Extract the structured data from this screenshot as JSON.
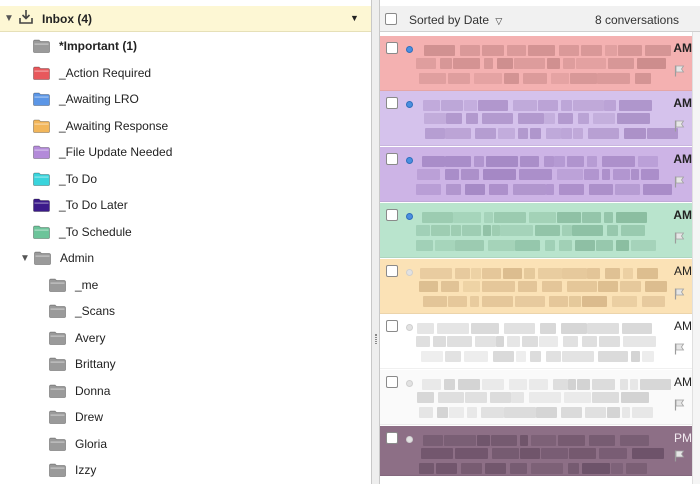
{
  "folders": {
    "inbox": {
      "label": "Inbox (4)",
      "icon": "download-tray-icon"
    },
    "items": [
      {
        "label": "*Important (1)",
        "color": "#9a9a9a",
        "bold": true
      },
      {
        "label": "_Action Required",
        "color": "#e8585c"
      },
      {
        "label": "_Awaiting LRO",
        "color": "#5b96e6"
      },
      {
        "label": "_Awaiting Response",
        "color": "#f2b65a"
      },
      {
        "label": "_File Update Needed",
        "color": "#b38ad9"
      },
      {
        "label": "_To Do",
        "color": "#39d4dc"
      },
      {
        "label": "_To Do Later",
        "color": "#3b1a8a"
      },
      {
        "label": "_To Schedule",
        "color": "#6cc49a"
      },
      {
        "label": "Admin",
        "color": "#9a9a9a",
        "expanded": true
      },
      {
        "label": "_me",
        "color": "#9a9a9a",
        "child": true
      },
      {
        "label": "_Scans",
        "color": "#9a9a9a",
        "child": true
      },
      {
        "label": "Avery",
        "color": "#9a9a9a",
        "child": true
      },
      {
        "label": "Brittany",
        "color": "#9a9a9a",
        "child": true
      },
      {
        "label": "Donna",
        "color": "#9a9a9a",
        "child": true
      },
      {
        "label": "Drew",
        "color": "#9a9a9a",
        "child": true
      },
      {
        "label": "Gloria",
        "color": "#9a9a9a",
        "child": true
      },
      {
        "label": "Izzy",
        "color": "#9a9a9a",
        "child": true
      }
    ]
  },
  "message_list": {
    "sort_label": "Sorted by Date",
    "count_label": "8 conversations",
    "messages": [
      {
        "time": "AM",
        "bold": true,
        "unread": true,
        "bg": "#f4b1b1",
        "blur": "#c98a8a"
      },
      {
        "time": "AM",
        "bold": true,
        "unread": true,
        "bg": "#d5c2ec",
        "blur": "#a68bc4"
      },
      {
        "time": "AM",
        "bold": true,
        "unread": true,
        "bg": "#cdb4e6",
        "blur": "#9f82c0"
      },
      {
        "time": "AM",
        "bold": true,
        "unread": true,
        "bg": "#b9e4cd",
        "blur": "#86b99c"
      },
      {
        "time": "AM",
        "bold": false,
        "unread": false,
        "bg": "#fbe2b6",
        "blur": "#d6b688"
      },
      {
        "time": "AM",
        "bold": false,
        "unread": false,
        "bg": "#ffffff",
        "blur": "#cfcfcf"
      },
      {
        "time": "AM",
        "bold": false,
        "unread": false,
        "bg": "#fafafa",
        "blur": "#cdcdcd"
      },
      {
        "time": "PM",
        "bold": false,
        "unread": false,
        "bg": "#8d6f86",
        "blur": "#6a5066"
      }
    ]
  }
}
